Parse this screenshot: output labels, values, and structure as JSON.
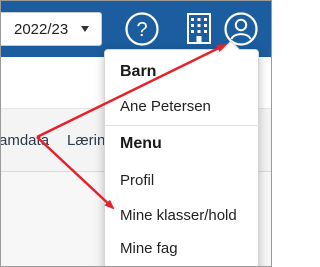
{
  "topbar": {
    "year_select": {
      "value": "2022/23",
      "icon": "chevron-down-icon"
    },
    "icons": [
      "help-icon",
      "building-icon",
      "profile-icon"
    ],
    "help_glyph": "?",
    "bg_color": "#1b5d9e"
  },
  "nav": {
    "items": [
      "amdata",
      "Lærin"
    ]
  },
  "dropdown": {
    "sections": [
      {
        "header": "Barn",
        "items": [
          "Ane Petersen"
        ]
      },
      {
        "header": "Menu",
        "items": [
          "Profil",
          "Mine klasser/hold",
          "Mine fag"
        ]
      }
    ]
  },
  "annotations": {
    "arrow_color": "#e8202a"
  }
}
